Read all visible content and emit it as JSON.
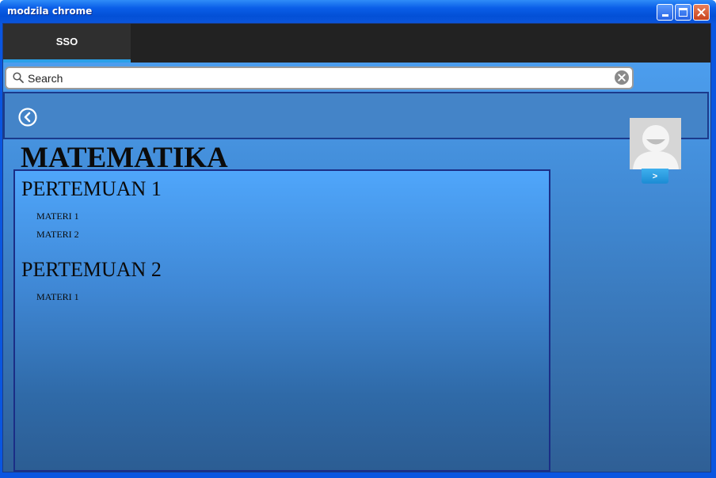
{
  "window": {
    "title": "modzila chrome"
  },
  "nav": {
    "tab_label": "SSO",
    "accent_color": "#2ba0e8"
  },
  "search": {
    "placeholder": "Search"
  },
  "avatar": {
    "button_label": ">"
  },
  "course": {
    "title": "MATEMATIKA",
    "sessions": [
      {
        "title": "PERTEMUAN 1",
        "materials": [
          "MATERI 1",
          "MATERI 2"
        ]
      },
      {
        "title": "PERTEMUAN 2",
        "materials": [
          "MATERI 1"
        ]
      }
    ]
  },
  "icons": {
    "search": "search-icon",
    "clear": "clear-icon",
    "back": "back-arrow-icon",
    "avatar": "user-avatar-icon",
    "minimize": "minimize-icon",
    "maximize": "maximize-icon",
    "close": "close-icon"
  }
}
